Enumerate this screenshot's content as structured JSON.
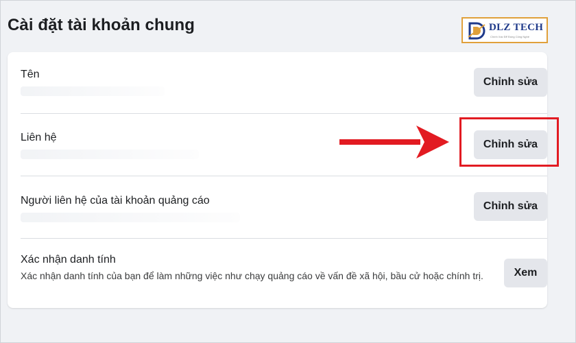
{
  "page": {
    "title": "Cài đặt tài khoản chung"
  },
  "logo": {
    "text": "DLZ TECH",
    "subtext": "Chính Xác Để Đúng Công Nghệ"
  },
  "rows": [
    {
      "title": "Tên",
      "button_label": "Chỉnh sửa"
    },
    {
      "title": "Liên hệ",
      "button_label": "Chỉnh sửa"
    },
    {
      "title": "Người liên hệ của tài khoản quảng cáo",
      "button_label": "Chỉnh sửa"
    },
    {
      "title": "Xác nhận danh tính",
      "description": "Xác nhận danh tính của bạn để làm những việc như chạy quảng cáo về vấn đề xã hội, bầu cử hoặc chính trị.",
      "button_label": "Xem"
    }
  ],
  "colors": {
    "background": "#f0f2f5",
    "card": "#ffffff",
    "button": "#e4e6eb",
    "annotation_red": "#e21b22",
    "logo_blue": "#1f3a8a",
    "logo_border": "#e0a03a"
  },
  "annotation": {
    "arrow_icon": "right-arrow-icon",
    "highlight_target": "rows.1"
  }
}
